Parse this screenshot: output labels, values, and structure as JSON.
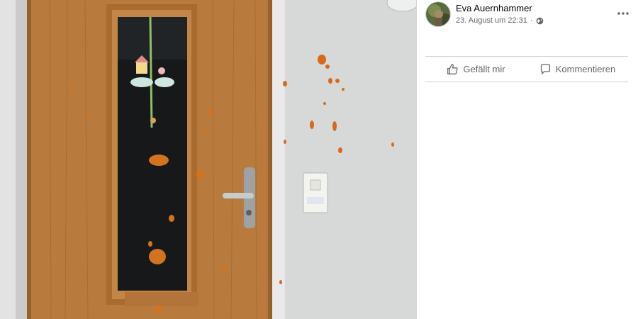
{
  "post": {
    "author": "Eva Auernhammer",
    "timestamp": "23. August um 22:31",
    "separator": "·",
    "privacy_icon": "globe-icon",
    "more_icon": "more-options-icon"
  },
  "actions": {
    "like_label": "Gefällt mir",
    "like_icon": "thumbs-up-icon",
    "comment_label": "Kommentieren",
    "comment_icon": "comment-icon"
  },
  "colors": {
    "text_primary": "#050505",
    "text_secondary": "#65676b",
    "divider": "#ced0d4",
    "door_wood": "#b77a3f",
    "egg_stain": "#d4731f"
  }
}
